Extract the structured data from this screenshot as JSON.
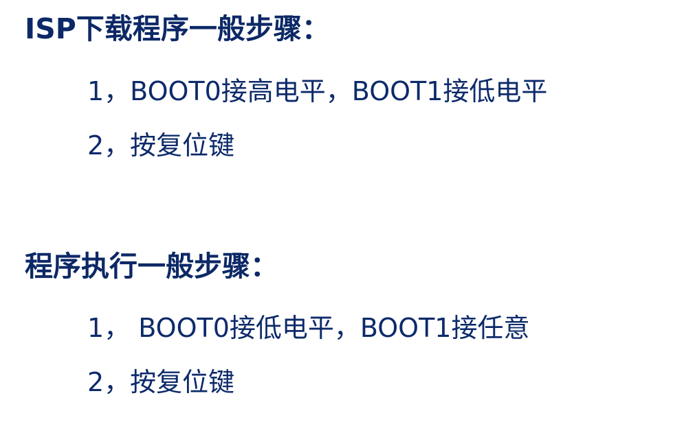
{
  "sections": [
    {
      "title": "ISP下载程序一般步骤：",
      "steps": [
        "1，BOOT0接高电平，BOOT1接低电平",
        "2，按复位键"
      ]
    },
    {
      "title": "程序执行一般步骤：",
      "steps": [
        "1， BOOT0接低电平，BOOT1接任意",
        "2，按复位键"
      ]
    }
  ]
}
